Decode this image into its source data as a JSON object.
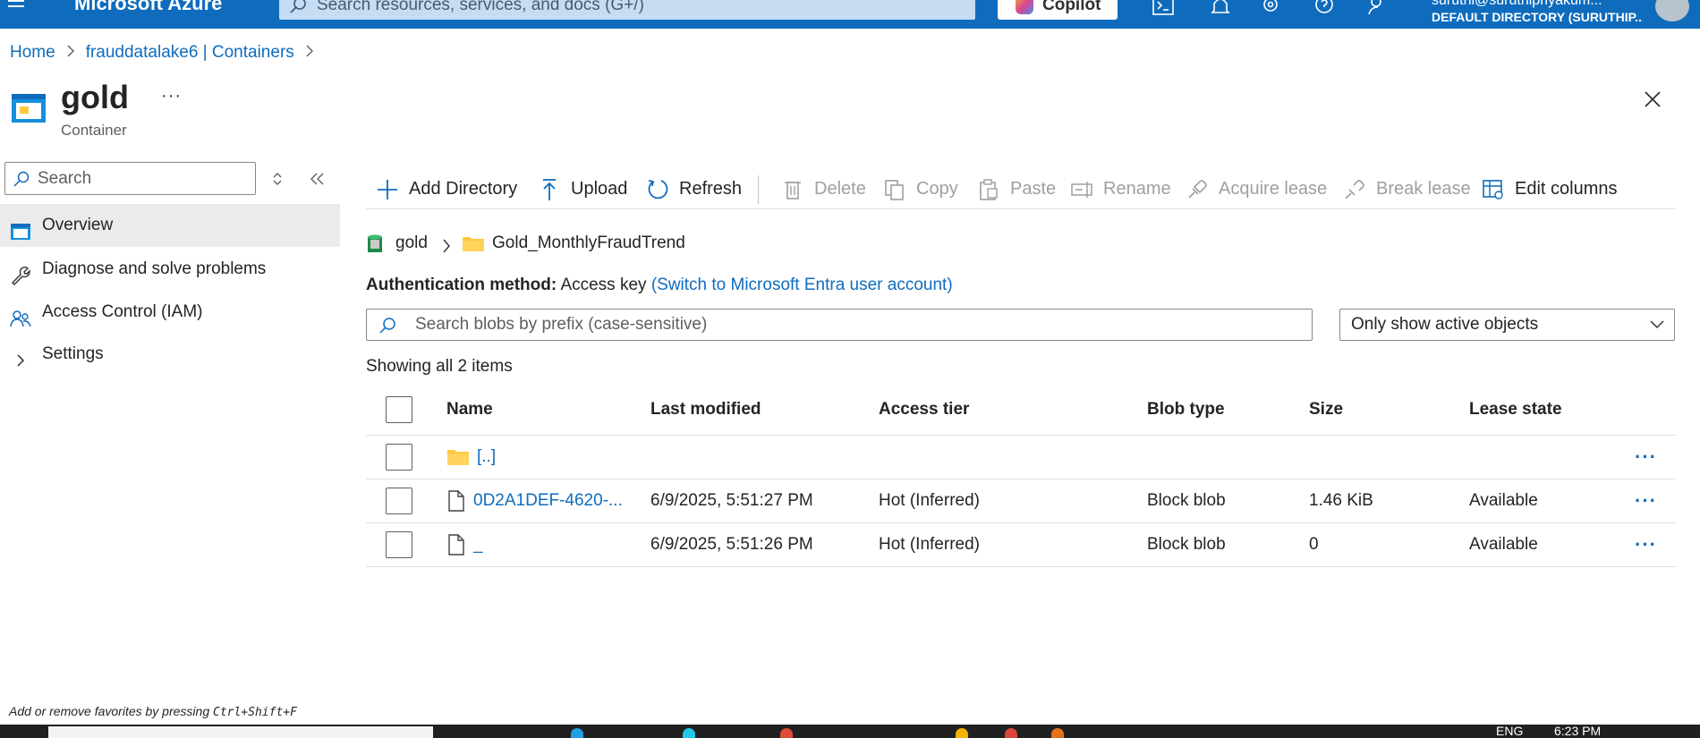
{
  "topbar": {
    "brand": "Microsoft Azure",
    "search_placeholder": "Search resources, services, and docs (G+/)",
    "copilot_label": "Copilot",
    "account_email": "suruthi@suruthipriyakum...",
    "account_directory": "DEFAULT DIRECTORY (SURUTHIP...",
    "icons": [
      "hamburger-icon",
      "cloud-shell-icon",
      "notifications-icon",
      "settings-icon",
      "help-icon",
      "feedback-icon"
    ]
  },
  "breadcrumb": {
    "items": [
      "Home",
      "frauddatalake6 | Containers"
    ]
  },
  "page": {
    "title": "gold",
    "subtitle": "Container",
    "more": "···"
  },
  "sidebar": {
    "search_placeholder": "Search",
    "items": [
      {
        "label": "Overview",
        "icon": "overview-icon"
      },
      {
        "label": "Diagnose and solve problems",
        "icon": "wrench-icon"
      },
      {
        "label": "Access Control (IAM)",
        "icon": "people-icon"
      },
      {
        "label": "Settings",
        "icon": "chevron-right-icon"
      }
    ]
  },
  "toolbar": {
    "add_directory": "Add Directory",
    "upload": "Upload",
    "refresh": "Refresh",
    "delete": "Delete",
    "copy": "Copy",
    "paste": "Paste",
    "rename": "Rename",
    "acquire_lease": "Acquire lease",
    "break_lease": "Break lease",
    "edit_columns": "Edit columns"
  },
  "path": {
    "container": "gold",
    "folder": "Gold_MonthlyFraudTrend"
  },
  "auth": {
    "label": "Authentication method:",
    "value": "Access key",
    "switch_link": "(Switch to Microsoft Entra user account)"
  },
  "filters": {
    "search_placeholder": "Search blobs by prefix (case-sensitive)",
    "active_objects": "Only show active objects"
  },
  "showing": "Showing all 2 items",
  "table": {
    "columns": [
      "Name",
      "Last modified",
      "Access tier",
      "Blob type",
      "Size",
      "Lease state"
    ],
    "rows": [
      {
        "name": "[..]",
        "type": "folder",
        "modified": "",
        "tier": "",
        "blob_type": "",
        "size": "",
        "lease": ""
      },
      {
        "name": "0D2A1DEF-4620-...",
        "type": "file",
        "modified": "6/9/2025, 5:51:27 PM",
        "tier": "Hot (Inferred)",
        "blob_type": "Block blob",
        "size": "1.46 KiB",
        "lease": "Available"
      },
      {
        "name": "_",
        "type": "file",
        "modified": "6/9/2025, 5:51:26 PM",
        "tier": "Hot (Inferred)",
        "blob_type": "Block blob",
        "size": "0",
        "lease": "Available"
      }
    ],
    "row_more": "···"
  },
  "footer": {
    "fav_hint": "Add or remove favorites by pressing ",
    "fav_keys": "Ctrl+Shift+F"
  },
  "taskbar": {
    "language": "ENG",
    "time": "6:23 PM"
  },
  "colors": {
    "azure_blue": "#0f6cbd",
    "folder_yellow": "#ffc83d",
    "taskbar": "#202020"
  }
}
